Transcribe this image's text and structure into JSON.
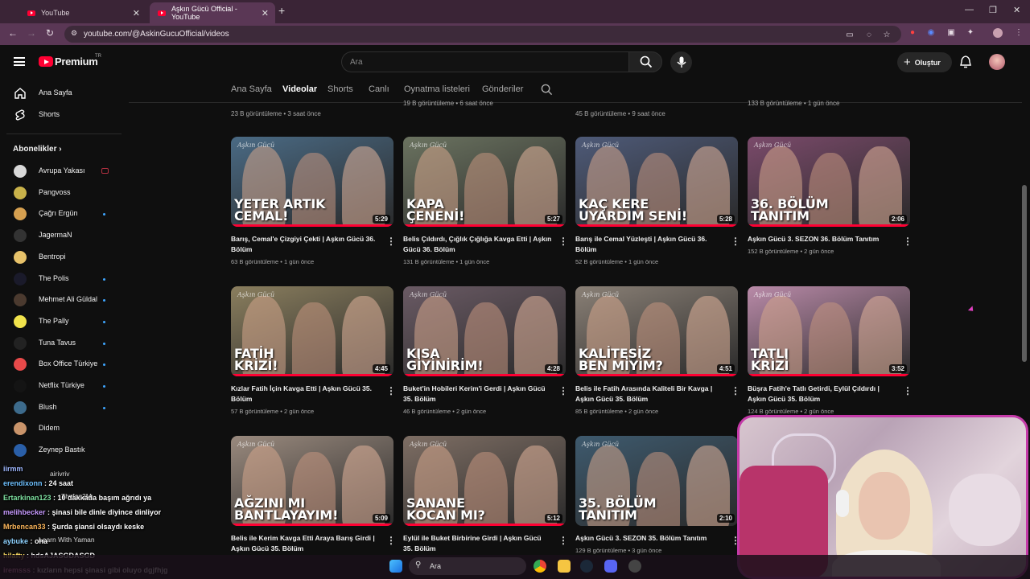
{
  "browser": {
    "tabs": [
      {
        "title": "YouTube"
      },
      {
        "title": "Aşkın Gücü Official - YouTube"
      }
    ],
    "url": "youtube.com/@AskinGucuOfficial/videos"
  },
  "header": {
    "logo_text": "Premium",
    "logo_sup": "TR",
    "search_placeholder": "Ara",
    "create_label": "Oluştur"
  },
  "sidebar": {
    "home": "Ana Sayfa",
    "shorts": "Shorts",
    "subscriptions_header": "Abonelikler",
    "channels": [
      {
        "name": "Avrupa Yakası",
        "live": true,
        "color": "#d8d8d8"
      },
      {
        "name": "Pangvoss",
        "dot": false,
        "color": "#c9b24a"
      },
      {
        "name": "Çağrı Ergün",
        "dot": true,
        "color": "#d6a050"
      },
      {
        "name": "JagermaN",
        "dot": false,
        "color": "#333333"
      },
      {
        "name": "Bentropi",
        "dot": false,
        "color": "#e7c26a"
      },
      {
        "name": "The Polis",
        "dot": true,
        "color": "#1a1a2a"
      },
      {
        "name": "Mehmet Ali Güldal",
        "dot": true,
        "color": "#4b3a2f"
      },
      {
        "name": "The Pally",
        "dot": true,
        "color": "#f1e34c"
      },
      {
        "name": "Tuna Tavus",
        "dot": true,
        "color": "#222222"
      },
      {
        "name": "Box Office Türkiye",
        "dot": true,
        "color": "#e84a4a"
      },
      {
        "name": "Netflix Türkiye",
        "dot": true,
        "color": "#141414"
      },
      {
        "name": "Blush",
        "dot": true,
        "color": "#3d6b8c"
      },
      {
        "name": "Didem",
        "dot": false,
        "color": "#c9946a"
      },
      {
        "name": "Zeynep Bastık",
        "dot": false,
        "color": "#2a5fa8"
      }
    ]
  },
  "channel_tabs": [
    "Ana Sayfa",
    "Videolar",
    "Shorts",
    "Canlı",
    "Oynatma listeleri",
    "Gönderiler"
  ],
  "top_row_meta": [
    "23 B görüntüleme • 3 saat önce",
    "19 B görüntüleme • 6 saat önce",
    "45 B görüntüleme • 9 saat önce",
    "133 B görüntüleme • 1 gün önce"
  ],
  "videos": [
    {
      "overlay": "YETER ARTIK\nCEMAL!",
      "duration": "5:29",
      "title": "Barış, Cemal'e Çizgiyi Çekti | Aşkın Gücü 36. Bölüm",
      "meta": "63 B görüntüleme • 1 gün önce",
      "progress": 1.0,
      "bg": "#4a6a84"
    },
    {
      "overlay": "KAPA\nÇENENİ!",
      "duration": "5:27",
      "title": "Belis Çıldırdı, Çığlık Çığlığa Kavga Etti | Aşkın Gücü 36. Bölüm",
      "meta": "131 B görüntüleme • 1 gün önce",
      "progress": 1.0,
      "bg": "#6b7360"
    },
    {
      "overlay": "KAÇ KERE\nUYARDIM SENİ!",
      "duration": "5:28",
      "title": "Barış ile Cemal Yüzleşti | Aşkın Gücü 36. Bölüm",
      "meta": "52 B görüntüleme • 1 gün önce",
      "progress": 1.0,
      "bg": "#4e5a78"
    },
    {
      "overlay": "36. BÖLÜM\nTANITIM",
      "duration": "2:06",
      "title": "Aşkın Gücü 3. SEZON 36. Bölüm Tanıtım",
      "meta": "152 B görüntüleme • 2 gün önce",
      "progress": 1.0,
      "bg": "#7a4a6a"
    },
    {
      "overlay": "FATİH\nKRİZİ!",
      "duration": "4:45",
      "title": "Kızlar Fatih İçin Kavga Etti | Aşkın Gücü 35. Bölüm",
      "meta": "57 B görüntüleme • 2 gün önce",
      "progress": 1.0,
      "bg": "#8a7e5e"
    },
    {
      "overlay": "KISA\nGİYİNİRİM!",
      "duration": "4:28",
      "title": "Buket'in Hobileri Kerim'i Gerdi | Aşkın Gücü 35. Bölüm",
      "meta": "46 B görüntüleme • 2 gün önce",
      "progress": 1.0,
      "bg": "#6a5a64"
    },
    {
      "overlay": "KALİTESİZ\nBEN MİYİM?",
      "duration": "4:51",
      "title": "Belis ile Fatih Arasında Kaliteli Bir Kavga | Aşkın Gücü 35. Bölüm",
      "meta": "85 B görüntüleme • 2 gün önce",
      "progress": 1.0,
      "bg": "#8a8076"
    },
    {
      "overlay": "TATLI\nKRİZİ",
      "duration": "3:52",
      "title": "Büşra Fatih'e Tatlı Getirdi, Eylül Çıldırdı | Aşkın Gücü 35. Bölüm",
      "meta": "124 B görüntüleme • 2 gün önce",
      "progress": 1.0,
      "bg": "#b98aa8"
    },
    {
      "overlay": "AĞZINI MI\nBANTLAYAYIM!",
      "duration": "5:09",
      "title": "Belis ile Kerim Kavga Etti Araya Barış Girdi | Aşkın Gücü 35. Bölüm",
      "meta": "",
      "progress": 1.0,
      "bg": "#9a8a7e"
    },
    {
      "overlay": "SANANE\nKOCAN MI?",
      "duration": "5:12",
      "title": "Eylül ile Buket Birbirine Girdi | Aşkın Gücü 35. Bölüm",
      "meta": "",
      "progress": 1.0,
      "bg": "#7e6e64"
    },
    {
      "overlay": "35. BÖLÜM\nTANITIM",
      "duration": "2:10",
      "title": "Aşkın Gücü 3. SEZON 35. Bölüm Tanıtım",
      "meta": "129 B görüntüleme • 3 gün önce",
      "progress": 0.0,
      "bg": "#3e5a6e"
    }
  ],
  "chat": [
    {
      "user": "iirmm",
      "text": "",
      "color": "#9fb8ff"
    },
    {
      "user": "erendixonn",
      "text": "24 saat",
      "color": "#6ec1ff"
    },
    {
      "user": "Ertarkinan123",
      "text": "10 dakkada başım ağrıdı ya",
      "color": "#7ee0a0"
    },
    {
      "user": "melihbecker",
      "text": "şinasi bile dinle diyince dinliyor",
      "color": "#c89bff"
    },
    {
      "user": "Mrbencan33",
      "text": "Şurda şiansi olsaydı keske",
      "color": "#ffb85c"
    },
    {
      "user": "aybuke",
      "text": "oha",
      "color": "#8fd3ff"
    },
    {
      "user": "hilafty",
      "text": "hdsAJASGDASGD",
      "color": "#ffe066"
    },
    {
      "user": "iremsss",
      "text": "kızların hepsi şinasi gibi oluyo dgjfhjg",
      "color": "#ff9ad5"
    }
  ],
  "sidebar_overlap": [
    "Thyfon2M",
    "Learn With Yaman",
    "airivriv"
  ],
  "taskbar": {
    "search_label": "Ara"
  }
}
